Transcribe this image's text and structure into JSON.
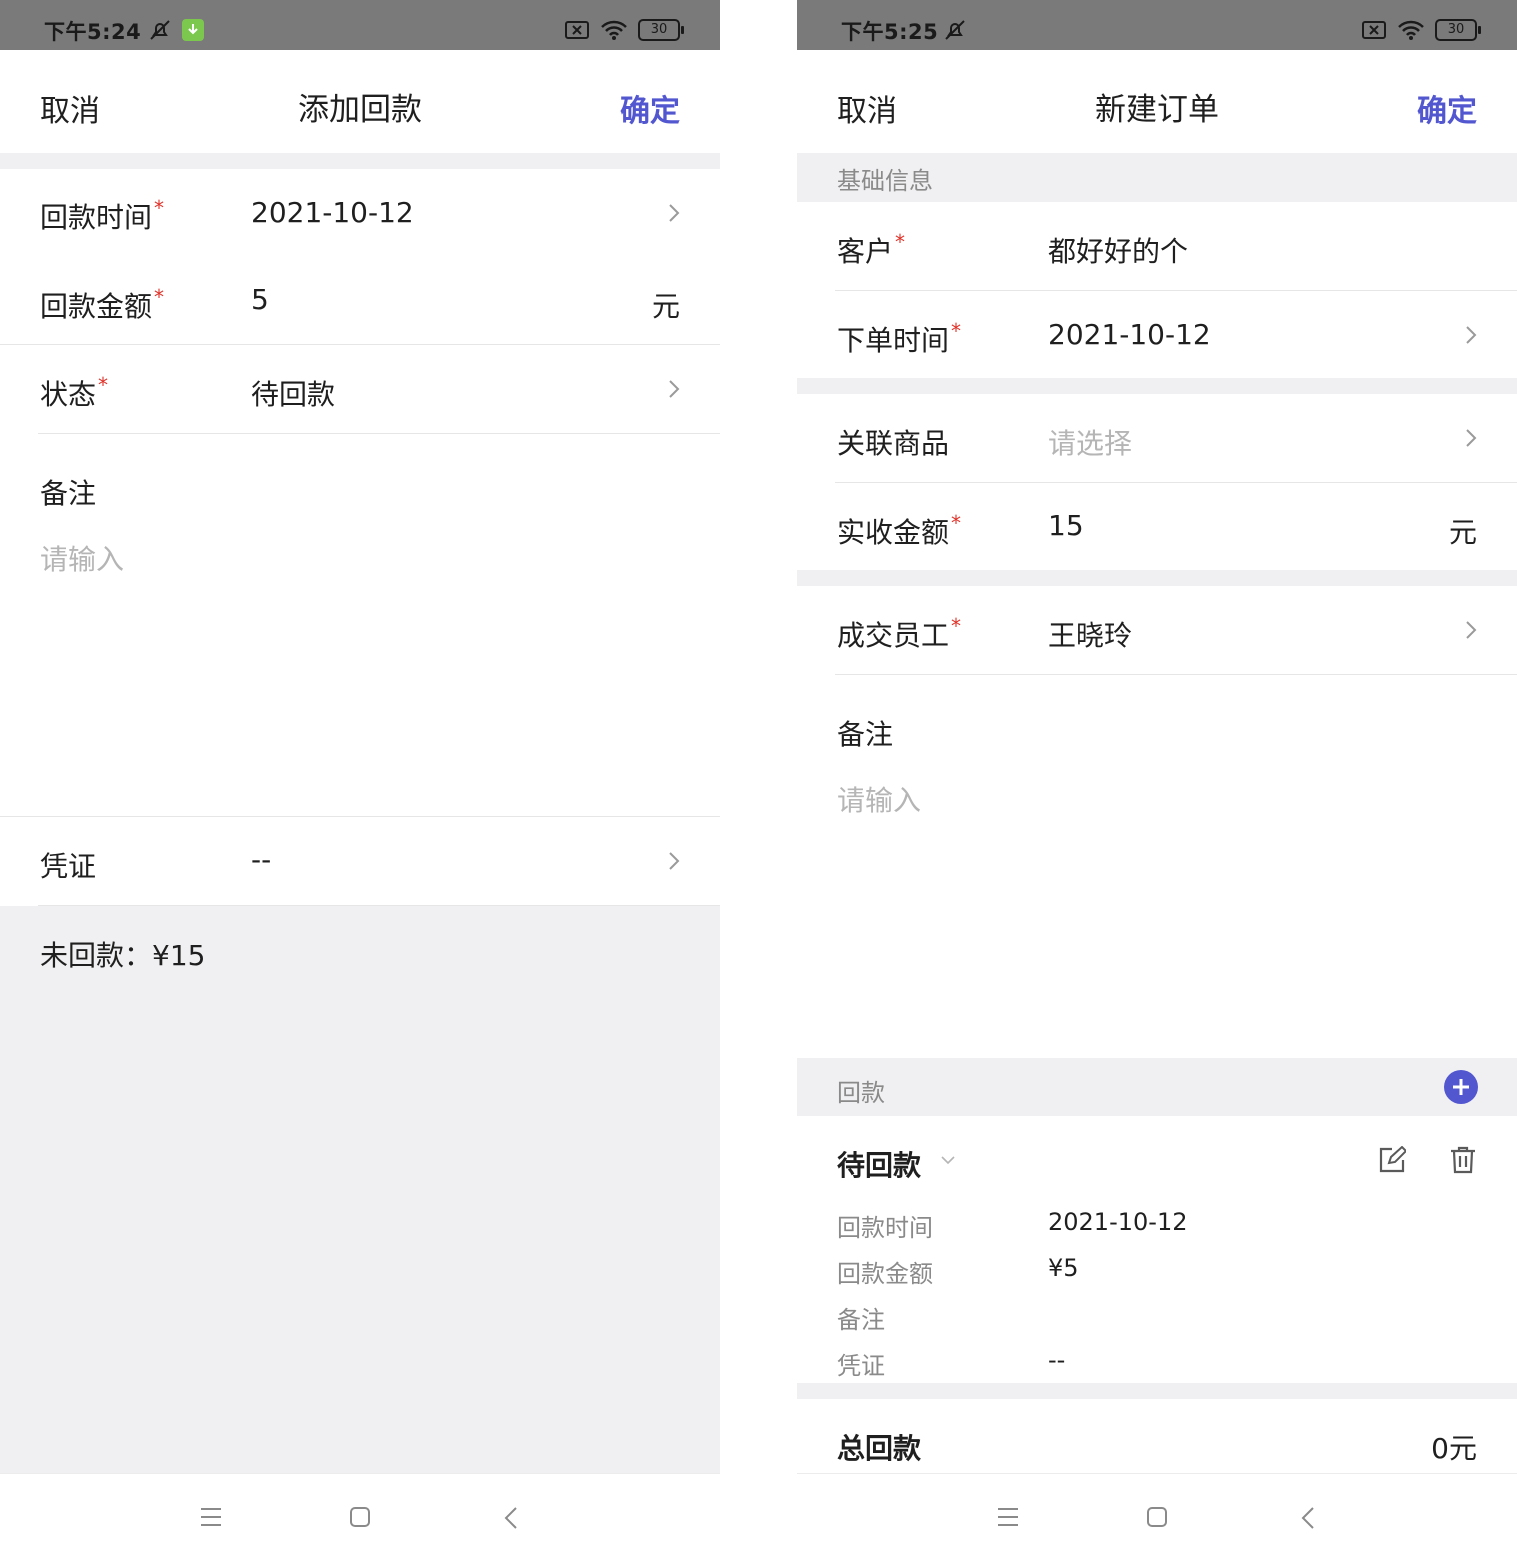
{
  "left": {
    "status": {
      "time": "下午5:24",
      "battery": "30"
    },
    "nav": {
      "cancel": "取消",
      "title": "添加回款",
      "confirm": "确定"
    },
    "fields": {
      "payment_time_label": "回款时间",
      "payment_time_value": "2021-10-12",
      "payment_amount_label": "回款金额",
      "payment_amount_value": "5",
      "payment_amount_unit": "元",
      "status_label": "状态",
      "status_value": "待回款",
      "remark_label": "备注",
      "remark_placeholder": "请输入",
      "voucher_label": "凭证",
      "voucher_value": "--"
    },
    "unpaid_text": "未回款：¥15",
    "required_mark": "*"
  },
  "right": {
    "status": {
      "time": "下午5:25",
      "battery": "30"
    },
    "nav": {
      "cancel": "取消",
      "title": "新建订单",
      "confirm": "确定"
    },
    "section_basic": "基础信息",
    "fields": {
      "customer_label": "客户",
      "customer_value": "都好好的个",
      "order_time_label": "下单时间",
      "order_time_value": "2021-10-12",
      "product_label": "关联商品",
      "product_placeholder": "请选择",
      "received_amount_label": "实收金额",
      "received_amount_value": "15",
      "received_amount_unit": "元",
      "staff_label": "成交员工",
      "staff_value": "王晓玲",
      "remark_label": "备注",
      "remark_placeholder": "请输入"
    },
    "section_payment": "回款",
    "payment_card": {
      "status": "待回款",
      "time_label": "回款时间",
      "time_value": "2021-10-12",
      "amount_label": "回款金额",
      "amount_value": "¥5",
      "remark_label": "备注",
      "remark_value": "",
      "voucher_label": "凭证",
      "voucher_value": "--"
    },
    "total_label": "总回款",
    "total_value": "0元",
    "required_mark": "*"
  },
  "colors": {
    "accent": "#5257d0",
    "required": "#e0332a",
    "background_gray": "#f0f0f2"
  }
}
